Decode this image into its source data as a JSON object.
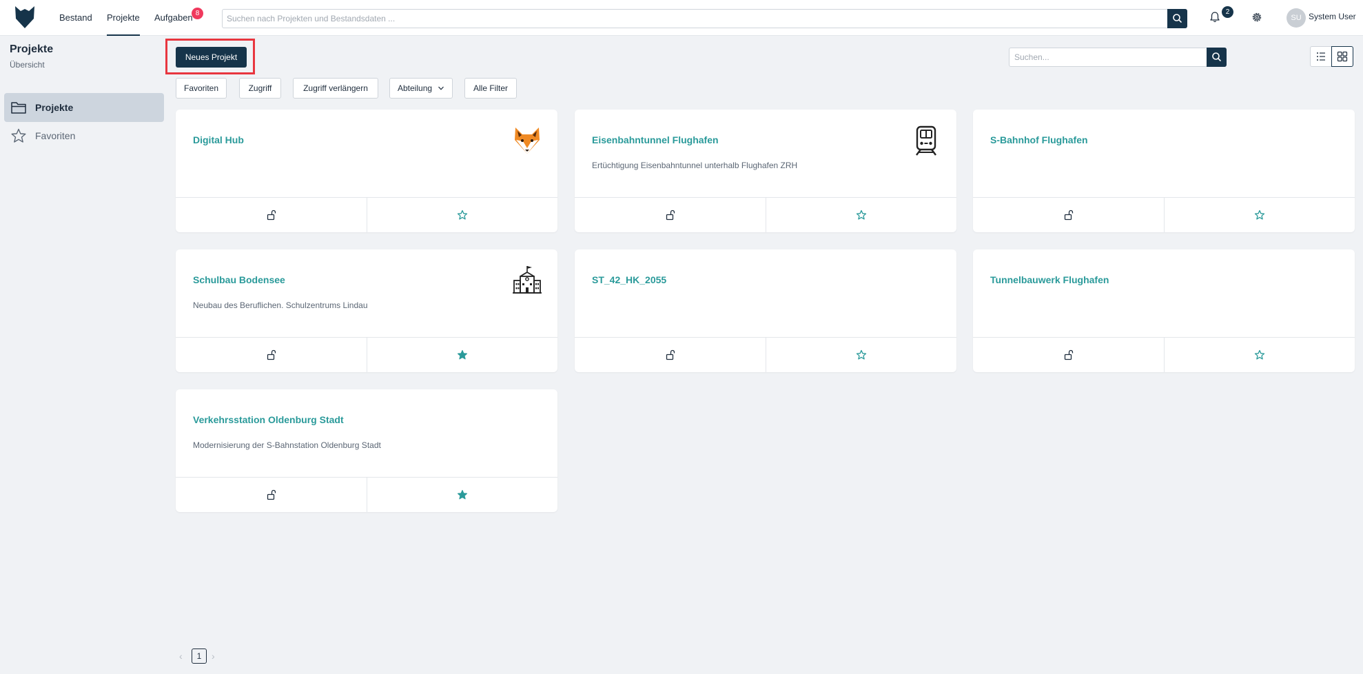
{
  "topbar": {
    "nav": [
      {
        "label": "Bestand"
      },
      {
        "label": "Projekte"
      },
      {
        "label": "Aufgaben",
        "badge": "8"
      }
    ],
    "search_placeholder": "Suchen nach Projekten und Bestandsdaten ...",
    "notifications_badge": "2",
    "avatar_initials": "SU",
    "user_name": "System User"
  },
  "sidebar": {
    "title": "Projekte",
    "subtitle": "Übersicht",
    "items": [
      {
        "label": "Projekte",
        "icon": "folder-icon",
        "active": true
      },
      {
        "label": "Favoriten",
        "icon": "star-icon",
        "active": false
      }
    ]
  },
  "toolbar": {
    "new_project_label": "Neues Projekt",
    "filters": [
      "Favoriten",
      "Zugriff",
      "Zugriff verlängern",
      "Abteilung",
      "Alle Filter"
    ],
    "search_placeholder": "Suchen..."
  },
  "projects": [
    {
      "title": "Digital Hub",
      "description": "",
      "icon": "fox-icon",
      "favorite": false
    },
    {
      "title": "Eisenbahntunnel Flughafen",
      "description": "Ertüchtigung Eisenbahntunnel unterhalb Flughafen ZRH",
      "icon": "train-icon",
      "favorite": false
    },
    {
      "title": "S-Bahnhof Flughafen",
      "description": "",
      "icon": "",
      "favorite": false
    },
    {
      "title": "Schulbau Bodensee",
      "description": "Neubau des Beruflichen. Schulzentrums Lindau",
      "icon": "school-icon",
      "favorite": true
    },
    {
      "title": "ST_42_HK_2055",
      "description": "",
      "icon": "",
      "favorite": false
    },
    {
      "title": "Tunnelbauwerk Flughafen",
      "description": "",
      "icon": "",
      "favorite": false
    },
    {
      "title": "Verkehrsstation Oldenburg Stadt",
      "description": "Modernisierung der S-Bahnstation Oldenburg Stadt",
      "icon": "",
      "favorite": true
    }
  ],
  "pagination": {
    "current": "1"
  },
  "colors": {
    "primary": "#16344a",
    "accent": "#2a9a9a",
    "badge": "#f0395d",
    "highlight": "#e8363f"
  }
}
